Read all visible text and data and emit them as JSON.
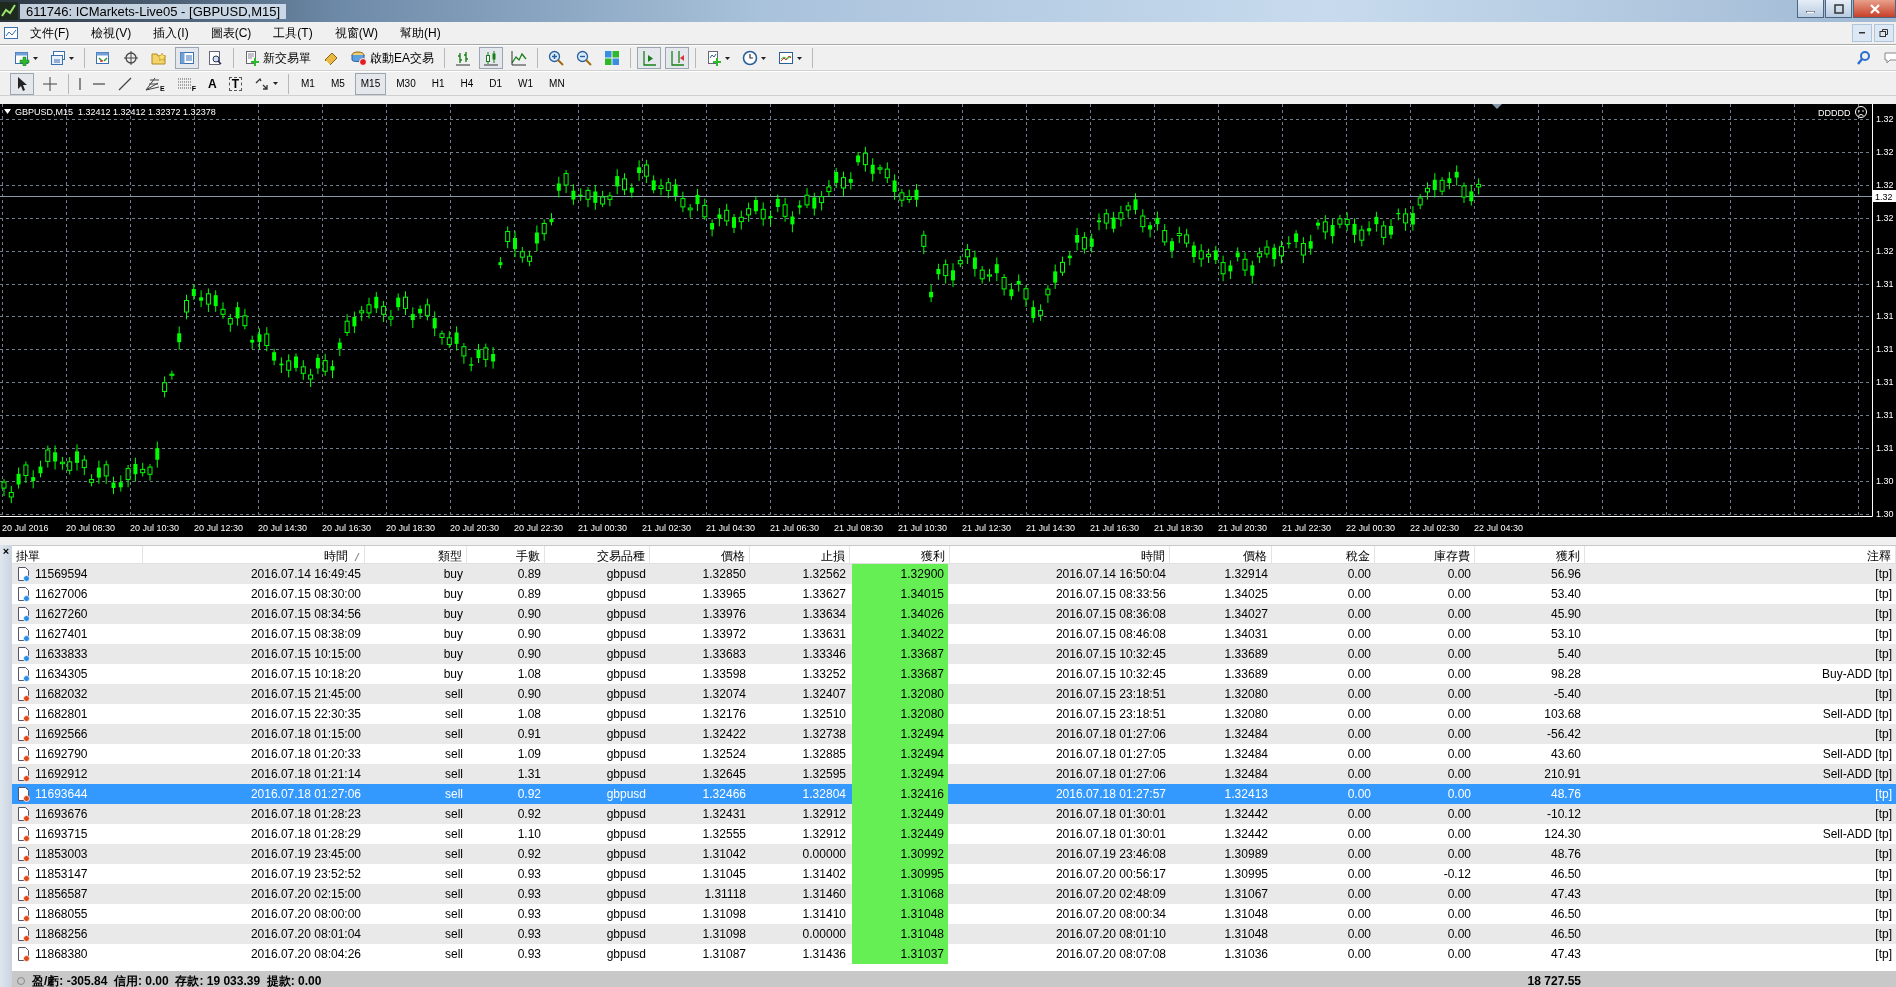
{
  "window": {
    "title": "611746: ICMarkets-Live05 - [GBPUSD,M15]"
  },
  "menu": [
    {
      "label": "文件(F)"
    },
    {
      "label": "檢視(V)"
    },
    {
      "label": "插入(I)"
    },
    {
      "label": "圖表(C)"
    },
    {
      "label": "工具(T)"
    },
    {
      "label": "視窗(W)"
    },
    {
      "label": "幫助(H)"
    }
  ],
  "toolbar": {
    "groups": [
      [
        {
          "kind": "new-chart",
          "pressed": false
        },
        {
          "kind": "profiles",
          "pressed": false
        }
      ],
      [
        {
          "kind": "market-watch",
          "pressed": false
        },
        {
          "kind": "data-window",
          "pressed": false
        },
        {
          "kind": "navigator",
          "pressed": false
        },
        {
          "kind": "terminal",
          "pressed": true
        },
        {
          "kind": "tester",
          "pressed": false
        }
      ],
      [
        {
          "kind": "new-order",
          "pressed": false,
          "label": "新交易單"
        },
        {
          "kind": "editor",
          "pressed": false
        },
        {
          "kind": "auto-trading",
          "pressed": false,
          "label": "啟動EA交易"
        }
      ],
      [
        {
          "kind": "bar-chart",
          "pressed": false
        },
        {
          "kind": "candle-chart",
          "pressed": true
        },
        {
          "kind": "line-chart",
          "pressed": false
        }
      ],
      [
        {
          "kind": "zoom-in",
          "pressed": false
        },
        {
          "kind": "zoom-out",
          "pressed": false
        },
        {
          "kind": "tile",
          "pressed": false
        }
      ],
      [
        {
          "kind": "auto-scroll",
          "pressed": true
        },
        {
          "kind": "chart-shift",
          "pressed": true
        }
      ],
      [
        {
          "kind": "indicators",
          "pressed": false
        },
        {
          "kind": "periods",
          "pressed": false
        },
        {
          "kind": "templates",
          "pressed": false
        }
      ]
    ]
  },
  "drawing_toolbar": {
    "groups": [
      [
        {
          "kind": "cursor",
          "pressed": true
        },
        {
          "kind": "crosshair",
          "pressed": false
        }
      ],
      [
        {
          "kind": "vertical-line",
          "pressed": false
        },
        {
          "kind": "horizontal-line",
          "pressed": false
        },
        {
          "kind": "trend-line",
          "pressed": false
        },
        {
          "kind": "fibo-fan",
          "pressed": false,
          "glyph": "E"
        },
        {
          "kind": "fibo-grid",
          "pressed": false,
          "glyph": "F"
        },
        {
          "kind": "text",
          "pressed": false,
          "glyph": "A"
        },
        {
          "kind": "text-label",
          "pressed": false,
          "glyph": "T"
        },
        {
          "kind": "arrows",
          "pressed": false
        }
      ]
    ]
  },
  "periods": [
    {
      "label": "M1",
      "selected": false
    },
    {
      "label": "M5",
      "selected": false
    },
    {
      "label": "M15",
      "selected": true
    },
    {
      "label": "M30",
      "selected": false
    },
    {
      "label": "H1",
      "selected": false
    },
    {
      "label": "H4",
      "selected": false
    },
    {
      "label": "D1",
      "selected": false
    },
    {
      "label": "W1",
      "selected": false
    },
    {
      "label": "MN",
      "selected": false
    }
  ],
  "chart": {
    "header": "GBPUSD,M15  1.32412 1.32412 1.32372 1.32378",
    "expert_label": "DDDDD",
    "current_price_label": "1.32",
    "price_labels": [
      "1.32",
      "1.32",
      "1.32",
      "1.32",
      "1.32",
      "1.31",
      "1.31",
      "1.31",
      "1.31",
      "1.31",
      "1.31",
      "1.30",
      "1.30"
    ],
    "time_labels": [
      "20 Jul 2016",
      "20 Jul 08:30",
      "20 Jul 10:30",
      "20 Jul 12:30",
      "20 Jul 14:30",
      "20 Jul 16:30",
      "20 Jul 18:30",
      "20 Jul 20:30",
      "20 Jul 22:30",
      "21 Jul 00:30",
      "21 Jul 02:30",
      "21 Jul 04:30",
      "21 Jul 06:30",
      "21 Jul 08:30",
      "21 Jul 10:30",
      "21 Jul 12:30",
      "21 Jul 14:30",
      "21 Jul 16:30",
      "21 Jul 18:30",
      "21 Jul 20:30",
      "21 Jul 22:30",
      "22 Jul 00:30",
      "22 Jul 02:30",
      "22 Jul 04:30"
    ]
  },
  "terminal": {
    "close_glyph": "×",
    "columns": [
      "掛單",
      "時間",
      "類型",
      "手數",
      "交易品種",
      "價格",
      "止損",
      "獲利",
      "時間",
      "價格",
      "稅金",
      "庫存費",
      "獲利",
      "注釋"
    ],
    "rows": [
      {
        "kind": "buy",
        "selected": false,
        "cells": [
          "11569594",
          "2016.07.14 16:49:45",
          "buy",
          "0.89",
          "gbpusd",
          "1.32850",
          "1.32562",
          "1.32900",
          "2016.07.14 16:50:04",
          "1.32914",
          "0.00",
          "0.00",
          "56.96",
          "[tp]"
        ]
      },
      {
        "kind": "buy",
        "selected": false,
        "cells": [
          "11627006",
          "2016.07.15 08:30:00",
          "buy",
          "0.89",
          "gbpusd",
          "1.33965",
          "1.33627",
          "1.34015",
          "2016.07.15 08:33:56",
          "1.34025",
          "0.00",
          "0.00",
          "53.40",
          "[tp]"
        ]
      },
      {
        "kind": "buy",
        "selected": false,
        "cells": [
          "11627260",
          "2016.07.15 08:34:56",
          "buy",
          "0.90",
          "gbpusd",
          "1.33976",
          "1.33634",
          "1.34026",
          "2016.07.15 08:36:08",
          "1.34027",
          "0.00",
          "0.00",
          "45.90",
          "[tp]"
        ]
      },
      {
        "kind": "buy",
        "selected": false,
        "cells": [
          "11627401",
          "2016.07.15 08:38:09",
          "buy",
          "0.90",
          "gbpusd",
          "1.33972",
          "1.33631",
          "1.34022",
          "2016.07.15 08:46:08",
          "1.34031",
          "0.00",
          "0.00",
          "53.10",
          "[tp]"
        ]
      },
      {
        "kind": "buy",
        "selected": false,
        "cells": [
          "11633833",
          "2016.07.15 10:15:00",
          "buy",
          "0.90",
          "gbpusd",
          "1.33683",
          "1.33346",
          "1.33687",
          "2016.07.15 10:32:45",
          "1.33689",
          "0.00",
          "0.00",
          "5.40",
          "[tp]"
        ]
      },
      {
        "kind": "buy",
        "selected": false,
        "cells": [
          "11634305",
          "2016.07.15 10:18:20",
          "buy",
          "1.08",
          "gbpusd",
          "1.33598",
          "1.33252",
          "1.33687",
          "2016.07.15 10:32:45",
          "1.33689",
          "0.00",
          "0.00",
          "98.28",
          "Buy-ADD [tp]"
        ]
      },
      {
        "kind": "sell",
        "selected": false,
        "cells": [
          "11682032",
          "2016.07.15 21:45:00",
          "sell",
          "0.90",
          "gbpusd",
          "1.32074",
          "1.32407",
          "1.32080",
          "2016.07.15 23:18:51",
          "1.32080",
          "0.00",
          "0.00",
          "-5.40",
          "[tp]"
        ]
      },
      {
        "kind": "sell",
        "selected": false,
        "cells": [
          "11682801",
          "2016.07.15 22:30:35",
          "sell",
          "1.08",
          "gbpusd",
          "1.32176",
          "1.32510",
          "1.32080",
          "2016.07.15 23:18:51",
          "1.32080",
          "0.00",
          "0.00",
          "103.68",
          "Sell-ADD [tp]"
        ]
      },
      {
        "kind": "sell",
        "selected": false,
        "cells": [
          "11692566",
          "2016.07.18 01:15:00",
          "sell",
          "0.91",
          "gbpusd",
          "1.32422",
          "1.32738",
          "1.32494",
          "2016.07.18 01:27:06",
          "1.32484",
          "0.00",
          "0.00",
          "-56.42",
          "[tp]"
        ]
      },
      {
        "kind": "sell",
        "selected": false,
        "cells": [
          "11692790",
          "2016.07.18 01:20:33",
          "sell",
          "1.09",
          "gbpusd",
          "1.32524",
          "1.32885",
          "1.32494",
          "2016.07.18 01:27:05",
          "1.32484",
          "0.00",
          "0.00",
          "43.60",
          "Sell-ADD [tp]"
        ]
      },
      {
        "kind": "sell",
        "selected": false,
        "cells": [
          "11692912",
          "2016.07.18 01:21:14",
          "sell",
          "1.31",
          "gbpusd",
          "1.32645",
          "1.32595",
          "1.32494",
          "2016.07.18 01:27:06",
          "1.32484",
          "0.00",
          "0.00",
          "210.91",
          "Sell-ADD [tp]"
        ]
      },
      {
        "kind": "sell",
        "selected": true,
        "cells": [
          "11693644",
          "2016.07.18 01:27:06",
          "sell",
          "0.92",
          "gbpusd",
          "1.32466",
          "1.32804",
          "1.32416",
          "2016.07.18 01:27:57",
          "1.32413",
          "0.00",
          "0.00",
          "48.76",
          "[tp]"
        ]
      },
      {
        "kind": "sell",
        "selected": false,
        "cells": [
          "11693676",
          "2016.07.18 01:28:23",
          "sell",
          "0.92",
          "gbpusd",
          "1.32431",
          "1.32912",
          "1.32449",
          "2016.07.18 01:30:01",
          "1.32442",
          "0.00",
          "0.00",
          "-10.12",
          "[tp]"
        ]
      },
      {
        "kind": "sell",
        "selected": false,
        "cells": [
          "11693715",
          "2016.07.18 01:28:29",
          "sell",
          "1.10",
          "gbpusd",
          "1.32555",
          "1.32912",
          "1.32449",
          "2016.07.18 01:30:01",
          "1.32442",
          "0.00",
          "0.00",
          "124.30",
          "Sell-ADD [tp]"
        ]
      },
      {
        "kind": "sell",
        "selected": false,
        "cells": [
          "11853003",
          "2016.07.19 23:45:00",
          "sell",
          "0.92",
          "gbpusd",
          "1.31042",
          "0.00000",
          "1.30992",
          "2016.07.19 23:46:08",
          "1.30989",
          "0.00",
          "0.00",
          "48.76",
          "[tp]"
        ]
      },
      {
        "kind": "sell",
        "selected": false,
        "cells": [
          "11853147",
          "2016.07.19 23:52:52",
          "sell",
          "0.93",
          "gbpusd",
          "1.31045",
          "1.31402",
          "1.30995",
          "2016.07.20 00:56:17",
          "1.30995",
          "0.00",
          "-0.12",
          "46.50",
          "[tp]"
        ]
      },
      {
        "kind": "sell",
        "selected": false,
        "cells": [
          "11856587",
          "2016.07.20 02:15:00",
          "sell",
          "0.93",
          "gbpusd",
          "1.31118",
          "1.31460",
          "1.31068",
          "2016.07.20 02:48:09",
          "1.31067",
          "0.00",
          "0.00",
          "47.43",
          "[tp]"
        ]
      },
      {
        "kind": "sell",
        "selected": false,
        "cells": [
          "11868055",
          "2016.07.20 08:00:00",
          "sell",
          "0.93",
          "gbpusd",
          "1.31098",
          "1.31410",
          "1.31048",
          "2016.07.20 08:00:34",
          "1.31048",
          "0.00",
          "0.00",
          "46.50",
          "[tp]"
        ]
      },
      {
        "kind": "sell",
        "selected": false,
        "cells": [
          "11868256",
          "2016.07.20 08:01:04",
          "sell",
          "0.93",
          "gbpusd",
          "1.31098",
          "0.00000",
          "1.31048",
          "2016.07.20 08:01:10",
          "1.31048",
          "0.00",
          "0.00",
          "46.50",
          "[tp]"
        ]
      },
      {
        "kind": "sell",
        "selected": false,
        "cells": [
          "11868380",
          "2016.07.20 08:04:26",
          "sell",
          "0.93",
          "gbpusd",
          "1.31087",
          "1.31436",
          "1.31037",
          "2016.07.20 08:07:08",
          "1.31036",
          "0.00",
          "0.00",
          "47.43",
          "[tp]"
        ]
      }
    ],
    "status": "盈/虧: -305.84  信用: 0.00  存款: 19 033.39  提款: 0.00",
    "total_profit": "18 727.55"
  }
}
